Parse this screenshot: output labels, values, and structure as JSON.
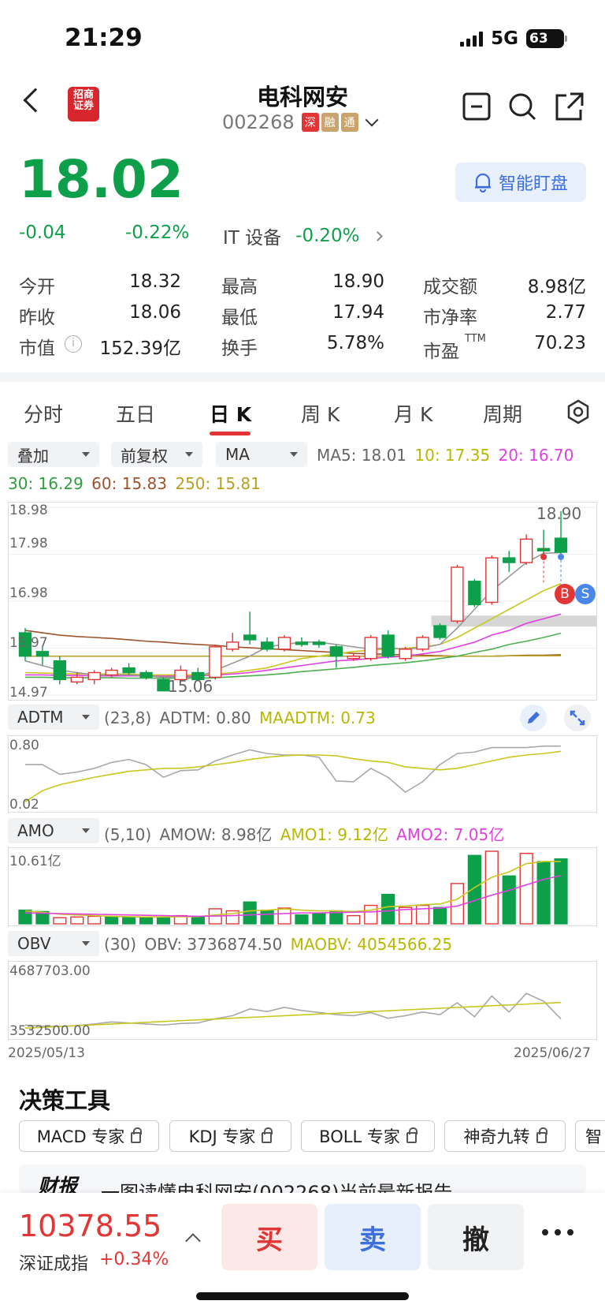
{
  "status": {
    "time": "21:29",
    "network": "5G",
    "battery": "63"
  },
  "header": {
    "logo_line1": "招商",
    "logo_line2": "证券",
    "name": "电科网安",
    "code": "002268",
    "tags": [
      "深",
      "融",
      "通"
    ]
  },
  "quote": {
    "price": "18.02",
    "change": "-0.04",
    "change_pct": "-0.22%",
    "sector": "IT 设备",
    "sector_pct": "-0.20%",
    "smart_button": "智能盯盘"
  },
  "stats": [
    {
      "label": "今开",
      "value": "18.32",
      "color": "red"
    },
    {
      "label": "最高",
      "value": "18.90",
      "color": "red"
    },
    {
      "label": "成交额",
      "value": "8.98亿",
      "color": ""
    },
    {
      "label": "昨收",
      "value": "18.06",
      "color": ""
    },
    {
      "label": "最低",
      "value": "17.94",
      "color": "green"
    },
    {
      "label": "市净率",
      "value": "2.77",
      "color": ""
    },
    {
      "label": "市值",
      "value": "152.39亿",
      "color": ""
    },
    {
      "label": "换手",
      "value": "5.78%",
      "color": ""
    },
    {
      "label": "市盈",
      "value": "70.23",
      "color": ""
    }
  ],
  "pe_sup": "TTM",
  "tabs": [
    "分时",
    "五日",
    "日 K",
    "周 K",
    "月 K",
    "周期"
  ],
  "selects": {
    "overlay": "叠加",
    "adjust": "前复权",
    "indicator": "MA"
  },
  "ma": {
    "ma5": "MA5: 18.01",
    "ma10": "10: 17.35",
    "ma20": "20: 16.70",
    "ma30": "30: 16.29",
    "ma60": "60: 15.83",
    "ma250": "250: 15.81"
  },
  "kline": {
    "y_labels": [
      "18.98",
      "17.98",
      "16.98",
      "15.97",
      "14.97"
    ],
    "high_label": "18.90",
    "low_label": "15.06",
    "buy_marker": "B",
    "sell_marker": "S"
  },
  "adtm": {
    "select": "ADTM",
    "params": "(23,8)",
    "value": "ADTM: 0.80",
    "ma": "MAADTM: 0.73",
    "y_top": "0.80",
    "y_bottom": "0.02"
  },
  "amo": {
    "select": "AMO",
    "params": "(5,10)",
    "value": "AMOW: 8.98亿",
    "amo1": "AMO1: 9.12亿",
    "amo2": "AMO2: 7.05亿",
    "y_top": "10.61亿"
  },
  "obv": {
    "select": "OBV",
    "params": "(30)",
    "value": "OBV: 3736874.50",
    "ma": "MAOBV: 4054566.25",
    "y_top": "4687703.00",
    "y_bottom": "3532500.00"
  },
  "dates": {
    "start": "2025/05/13",
    "end": "2025/06/27"
  },
  "tools": {
    "title": "决策工具",
    "items": [
      "MACD 专家",
      "KDJ 专家",
      "BOLL 专家",
      "神奇九转",
      "智"
    ]
  },
  "report": {
    "badge": "财报",
    "text": "一图读懂电科网安(002268)当前最新报告"
  },
  "bottom": {
    "index_value": "10378.55",
    "index_name": "深证成指",
    "index_change": "+0.34%",
    "buy": "买",
    "sell": "卖",
    "cancel": "撤"
  },
  "colors": {
    "up": "#e23535",
    "down": "#0e9f4b",
    "ma5": "#999999",
    "ma10": "#c8c820",
    "ma20": "#e040e0",
    "ma30": "#4caf50",
    "ma60": "#a0522d",
    "ma250": "#b8a020",
    "accent": "#3d6fe0"
  },
  "chart_data": {
    "type": "candlestick",
    "ylim": [
      14.97,
      18.98
    ],
    "candles": [
      {
        "o": 16.3,
        "c": 15.8,
        "h": 16.4,
        "l": 15.7
      },
      {
        "o": 15.9,
        "c": 15.8,
        "h": 16.0,
        "l": 15.6
      },
      {
        "o": 15.7,
        "c": 15.3,
        "h": 15.8,
        "l": 15.2
      },
      {
        "o": 15.25,
        "c": 15.35,
        "h": 15.45,
        "l": 15.2
      },
      {
        "o": 15.3,
        "c": 15.45,
        "h": 15.5,
        "l": 15.2
      },
      {
        "o": 15.4,
        "c": 15.5,
        "h": 15.55,
        "l": 15.35
      },
      {
        "o": 15.55,
        "c": 15.45,
        "h": 15.65,
        "l": 15.4
      },
      {
        "o": 15.45,
        "c": 15.35,
        "h": 15.5,
        "l": 15.3
      },
      {
        "o": 15.3,
        "c": 15.06,
        "h": 15.35,
        "l": 15.06
      },
      {
        "o": 15.3,
        "c": 15.5,
        "h": 15.6,
        "l": 15.25
      },
      {
        "o": 15.45,
        "c": 15.3,
        "h": 15.55,
        "l": 15.28
      },
      {
        "o": 15.35,
        "c": 16.0,
        "h": 16.05,
        "l": 15.3
      },
      {
        "o": 15.95,
        "c": 16.1,
        "h": 16.3,
        "l": 15.9
      },
      {
        "o": 16.25,
        "c": 16.15,
        "h": 16.75,
        "l": 16.05
      },
      {
        "o": 16.1,
        "c": 15.95,
        "h": 16.2,
        "l": 15.9
      },
      {
        "o": 15.95,
        "c": 16.2,
        "h": 16.25,
        "l": 15.9
      },
      {
        "o": 16.1,
        "c": 16.05,
        "h": 16.2,
        "l": 16.0
      },
      {
        "o": 16.1,
        "c": 16.05,
        "h": 16.15,
        "l": 15.98
      },
      {
        "o": 16.0,
        "c": 15.8,
        "h": 16.05,
        "l": 15.55
      },
      {
        "o": 15.75,
        "c": 15.8,
        "h": 15.85,
        "l": 15.7
      },
      {
        "o": 15.75,
        "c": 16.2,
        "h": 16.25,
        "l": 15.7
      },
      {
        "o": 16.25,
        "c": 15.8,
        "h": 16.35,
        "l": 15.75
      },
      {
        "o": 15.75,
        "c": 15.95,
        "h": 16.0,
        "l": 15.7
      },
      {
        "o": 15.95,
        "c": 16.2,
        "h": 16.25,
        "l": 15.9
      },
      {
        "o": 16.45,
        "c": 16.2,
        "h": 16.5,
        "l": 16.15
      },
      {
        "o": 16.55,
        "c": 17.7,
        "h": 17.75,
        "l": 16.5
      },
      {
        "o": 17.4,
        "c": 16.9,
        "h": 17.45,
        "l": 16.85
      },
      {
        "o": 16.95,
        "c": 17.9,
        "h": 17.95,
        "l": 16.9
      },
      {
        "o": 17.9,
        "c": 17.8,
        "h": 18.05,
        "l": 17.6
      },
      {
        "o": 17.8,
        "c": 18.3,
        "h": 18.4,
        "l": 17.75
      },
      {
        "o": 18.1,
        "c": 18.05,
        "h": 18.5,
        "l": 17.95
      },
      {
        "o": 18.32,
        "c": 18.02,
        "h": 18.9,
        "l": 17.94
      }
    ],
    "ma5": [
      15.7,
      15.6,
      15.5,
      15.45,
      15.4,
      15.4,
      15.4,
      15.38,
      15.35,
      15.36,
      15.35,
      15.5,
      15.65,
      15.8,
      16.0,
      16.05,
      16.1,
      16.1,
      16.05,
      16.0,
      15.95,
      15.98,
      15.95,
      15.98,
      16.05,
      16.4,
      16.8,
      17.2,
      17.5,
      17.8,
      18.0,
      18.01
    ],
    "ma10": [
      15.45,
      15.44,
      15.43,
      15.42,
      15.42,
      15.42,
      15.42,
      15.4,
      15.4,
      15.4,
      15.4,
      15.42,
      15.45,
      15.5,
      15.55,
      15.65,
      15.75,
      15.8,
      15.85,
      15.9,
      15.93,
      15.95,
      15.97,
      16.0,
      16.05,
      16.2,
      16.4,
      16.6,
      16.8,
      17.0,
      17.2,
      17.35
    ],
    "ma20": [
      15.4,
      15.4,
      15.39,
      15.39,
      15.38,
      15.38,
      15.38,
      15.38,
      15.38,
      15.38,
      15.38,
      15.4,
      15.42,
      15.45,
      15.5,
      15.55,
      15.6,
      15.65,
      15.7,
      15.72,
      15.75,
      15.78,
      15.8,
      15.85,
      15.9,
      16.0,
      16.1,
      16.25,
      16.35,
      16.5,
      16.6,
      16.7
    ],
    "ma30": [
      15.35,
      15.35,
      15.34,
      15.34,
      15.34,
      15.34,
      15.33,
      15.33,
      15.33,
      15.33,
      15.33,
      15.34,
      15.36,
      15.38,
      15.4,
      15.43,
      15.47,
      15.5,
      15.53,
      15.56,
      15.6,
      15.63,
      15.66,
      15.7,
      15.75,
      15.8,
      15.88,
      15.95,
      16.05,
      16.12,
      16.2,
      16.29
    ],
    "ma60": [
      16.35,
      16.3,
      16.25,
      16.22,
      16.2,
      16.18,
      16.15,
      16.12,
      16.1,
      16.07,
      16.05,
      16.03,
      16.0,
      15.98,
      15.96,
      15.94,
      15.92,
      15.9,
      15.88,
      15.86,
      15.85,
      15.84,
      15.83,
      15.82,
      15.81,
      15.8,
      15.8,
      15.8,
      15.81,
      15.82,
      15.82,
      15.83
    ],
    "ma250": [
      15.8,
      15.8,
      15.8,
      15.8,
      15.8,
      15.8,
      15.8,
      15.8,
      15.8,
      15.8,
      15.8,
      15.8,
      15.8,
      15.8,
      15.8,
      15.8,
      15.8,
      15.8,
      15.8,
      15.8,
      15.8,
      15.8,
      15.8,
      15.8,
      15.8,
      15.8,
      15.8,
      15.8,
      15.81,
      15.81,
      15.81,
      15.81
    ],
    "adtm": [
      0.55,
      0.55,
      0.42,
      0.45,
      0.5,
      0.58,
      0.62,
      0.55,
      0.38,
      0.47,
      0.48,
      0.6,
      0.68,
      0.75,
      0.7,
      0.68,
      0.68,
      0.65,
      0.33,
      0.32,
      0.5,
      0.38,
      0.18,
      0.32,
      0.55,
      0.7,
      0.72,
      0.78,
      0.78,
      0.78,
      0.8,
      0.8
    ],
    "maadtm": [
      0.05,
      0.2,
      0.28,
      0.33,
      0.38,
      0.42,
      0.46,
      0.48,
      0.5,
      0.5,
      0.52,
      0.55,
      0.58,
      0.62,
      0.65,
      0.67,
      0.68,
      0.68,
      0.67,
      0.63,
      0.6,
      0.58,
      0.52,
      0.5,
      0.48,
      0.5,
      0.55,
      0.6,
      0.65,
      0.68,
      0.7,
      0.73
    ],
    "amo_values": [
      2.0,
      1.8,
      0.9,
      1.0,
      1.1,
      1.0,
      0.9,
      0.9,
      1.0,
      1.2,
      1.0,
      2.2,
      1.9,
      3.2,
      2.0,
      2.3,
      1.3,
      1.5,
      1.9,
      1.2,
      2.7,
      4.3,
      2.4,
      2.7,
      2.4,
      5.9,
      10.0,
      10.61,
      7.0,
      10.3,
      9.1,
      9.5
    ],
    "amo_up": [
      false,
      false,
      true,
      true,
      true,
      false,
      false,
      false,
      false,
      true,
      false,
      true,
      true,
      false,
      false,
      true,
      false,
      false,
      false,
      true,
      true,
      false,
      true,
      true,
      false,
      true,
      false,
      true,
      false,
      true,
      false,
      false
    ],
    "amo1": [
      1.9,
      1.7,
      1.4,
      1.3,
      1.2,
      1.1,
      1.05,
      1.0,
      1.0,
      1.05,
      1.05,
      1.3,
      1.5,
      1.9,
      2.0,
      2.2,
      2.0,
      1.9,
      1.9,
      1.8,
      2.0,
      2.5,
      2.6,
      2.8,
      2.9,
      3.6,
      5.3,
      6.8,
      7.6,
      8.8,
      9.1,
      9.12
    ],
    "amo2": [
      1.6,
      1.55,
      1.5,
      1.45,
      1.4,
      1.35,
      1.3,
      1.25,
      1.2,
      1.15,
      1.1,
      1.15,
      1.2,
      1.3,
      1.4,
      1.5,
      1.6,
      1.6,
      1.65,
      1.7,
      1.75,
      1.9,
      2.1,
      2.2,
      2.3,
      2.6,
      3.4,
      4.2,
      4.9,
      5.7,
      6.5,
      7.05
    ],
    "obv": [
      3620000,
      3600000,
      3590000,
      3610000,
      3640000,
      3680000,
      3660000,
      3640000,
      3620000,
      3650000,
      3660000,
      3740000,
      3800000,
      3930000,
      3880000,
      3960000,
      3900000,
      3860000,
      3820000,
      3800000,
      3860000,
      3750000,
      3800000,
      3870000,
      3820000,
      4050000,
      3780000,
      4180000,
      3870000,
      4230000,
      4080000,
      3736874
    ]
  }
}
